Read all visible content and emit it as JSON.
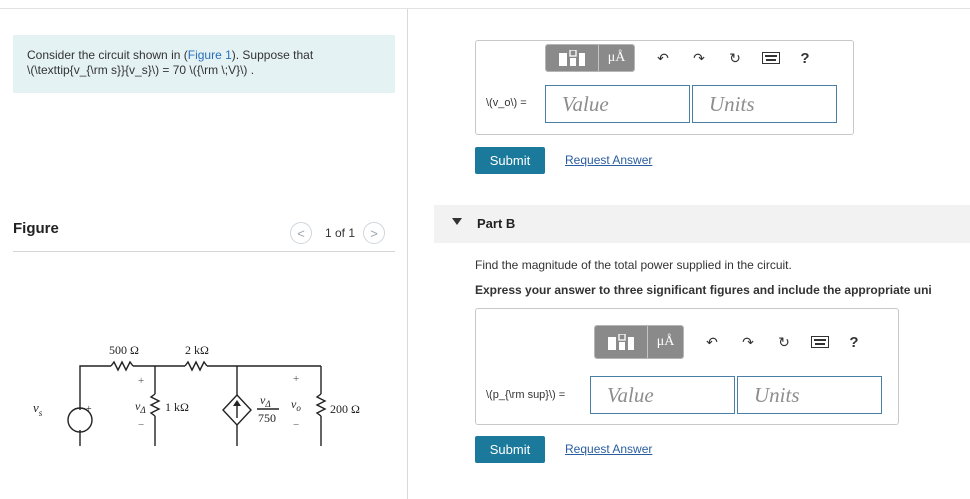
{
  "intro": {
    "text_before": "Consider the circuit shown in (",
    "figure_link": "Figure 1",
    "text_after": "). Suppose that",
    "math_line": "\\(\\texttip{v_{\\rm s}}{v_s}\\) = 70 \\({\\rm \\;V}\\) ."
  },
  "figure": {
    "label": "Figure",
    "pager": {
      "prev": "<",
      "next": ">",
      "count": "1 of 1"
    },
    "circuit": {
      "source": "v",
      "source_sub": "s",
      "r_500": "500 Ω",
      "r_2k": "2 kΩ",
      "r_1k": "1 kΩ",
      "r_200": "200 Ω",
      "vdelta": "v",
      "vdelta_sub": "Δ",
      "vo": "v",
      "vo_sub": "o",
      "ctrl_num_v": "v",
      "ctrl_num_sub": "Δ",
      "ctrl_den": "750",
      "plus": "+",
      "minus": "−"
    }
  },
  "toolbar": {
    "templates_icon": "templates-icon",
    "units_label": "μÅ",
    "undo_icon": "↶",
    "redo_icon": "↷",
    "reset_icon": "↻",
    "keyboard_icon": "keyboard-icon",
    "help_label": "?"
  },
  "part_a": {
    "answer_label": "\\(v_o\\) =",
    "value_placeholder": "Value",
    "units_placeholder": "Units",
    "submit_label": "Submit",
    "request_label": "Request Answer"
  },
  "part_b": {
    "title": "Part B",
    "prompt": "Find the magnitude of the total power supplied in the circuit.",
    "instruction": "Express your answer to three significant figures and include the appropriate uni",
    "answer_label": "\\(p_{\\rm sup}\\) =",
    "value_placeholder": "Value",
    "units_placeholder": "Units",
    "submit_label": "Submit",
    "request_label": "Request Answer"
  },
  "colors": {
    "intro_bg": "#e4f2f4",
    "submit_bg": "#1b7a9c",
    "link": "#2a5d9f",
    "field_border": "#4a7fa5",
    "toolbar_btn": "#8a8a8a"
  }
}
